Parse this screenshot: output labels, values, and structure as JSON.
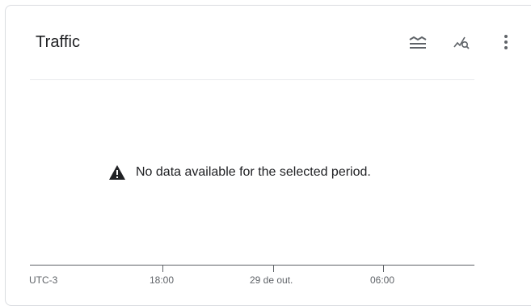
{
  "card": {
    "title": "Traffic",
    "actions": {
      "legend_icon": "legend-toggle-icon",
      "explore_icon": "explore-query-icon",
      "more_icon": "more-vert-icon"
    },
    "message": {
      "icon": "warning-icon",
      "text": "No data available for the selected period."
    },
    "x_axis": {
      "timezone": "UTC-3",
      "ticks": [
        "18:00",
        "29 de out.",
        "06:00"
      ]
    }
  },
  "colors": {
    "text_primary": "#202124",
    "text_secondary": "#5f6368",
    "border": "#dadce0",
    "divider": "#e8eaed"
  }
}
